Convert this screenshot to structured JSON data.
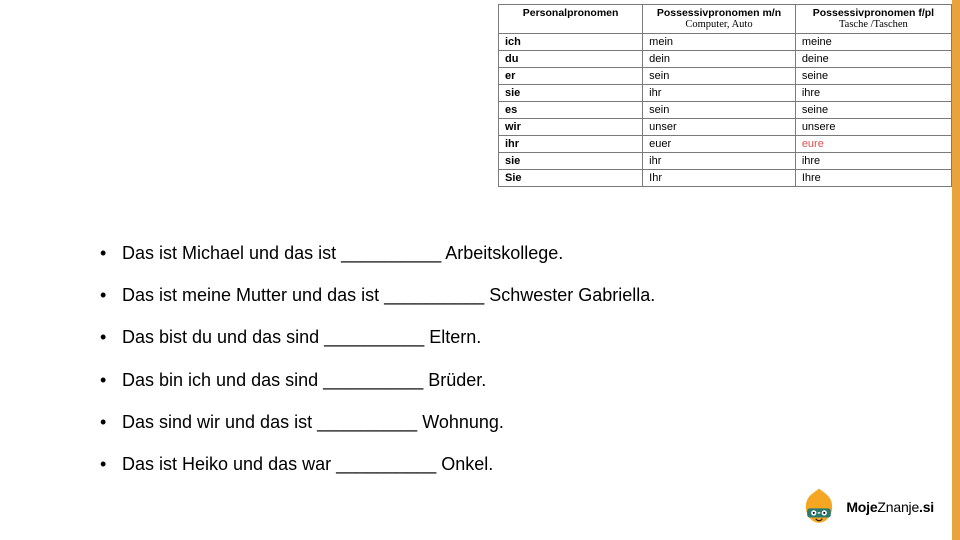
{
  "table": {
    "headers": {
      "personal": "Personalpronomen",
      "poss_mn": "Possessivpronomen m/n",
      "poss_mn_sub": "Computer, Auto",
      "poss_fpl": "Possessivpronomen f/pl",
      "poss_fpl_sub": "Tasche /Taschen"
    },
    "rows": [
      {
        "p": "ich",
        "a": "mein",
        "b": "meine"
      },
      {
        "p": "du",
        "a": "dein",
        "b": "deine"
      },
      {
        "p": "er",
        "a": "sein",
        "b": "seine"
      },
      {
        "p": "sie",
        "a": "ihr",
        "b": "ihre"
      },
      {
        "p": "es",
        "a": "sein",
        "b": "seine"
      },
      {
        "p": "wir",
        "a": "unser",
        "b": "unsere"
      },
      {
        "p": "ihr",
        "a": "euer",
        "b": "eure",
        "b_red": true
      },
      {
        "p": "sie",
        "a": "ihr",
        "b": "ihre"
      },
      {
        "p": "Sie",
        "a": "Ihr",
        "b": "Ihre"
      }
    ]
  },
  "bullets": [
    "Das ist Michael und das ist __________ Arbeitskollege.",
    "Das ist meine Mutter und das ist __________ Schwester Gabriella.",
    "Das bist du und das sind __________ Eltern.",
    "Das bin ich und das sind __________ Brüder.",
    "Das sind wir und das ist __________ Wohnung.",
    "Das ist Heiko und das war __________  Onkel."
  ],
  "brand": {
    "part1": "Moje",
    "part2": "Znanje",
    "part3": ".si"
  }
}
